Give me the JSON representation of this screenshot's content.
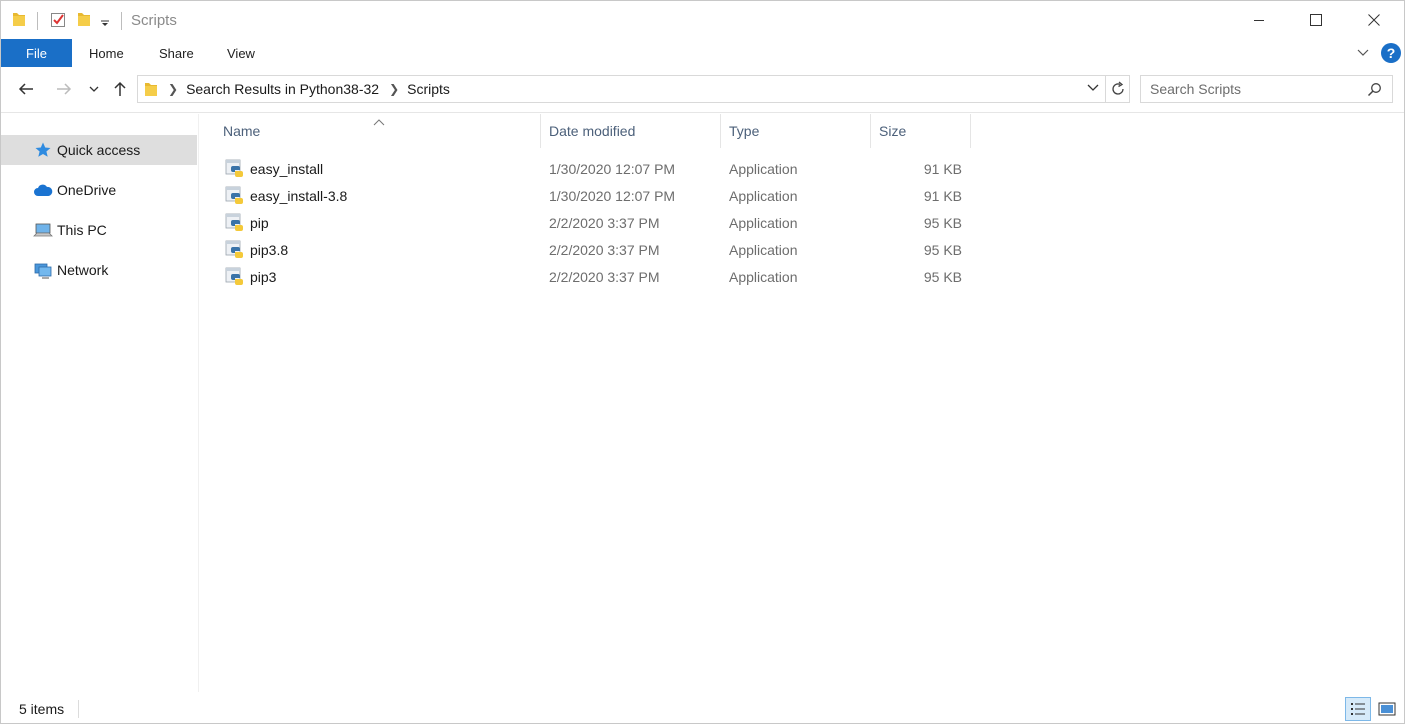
{
  "window": {
    "title": "Scripts"
  },
  "ribbon": {
    "file_label": "File",
    "tabs": [
      "Home",
      "Share",
      "View"
    ],
    "help_label": "?"
  },
  "address": {
    "breadcrumbs": [
      "Search Results in Python38-32",
      "Scripts"
    ]
  },
  "search": {
    "placeholder": "Search Scripts"
  },
  "navpane": {
    "items": [
      {
        "label": "Quick access",
        "icon": "star-icon"
      },
      {
        "label": "OneDrive",
        "icon": "cloud-icon"
      },
      {
        "label": "This PC",
        "icon": "computer-icon"
      },
      {
        "label": "Network",
        "icon": "network-icon"
      }
    ]
  },
  "columns": {
    "name": "Name",
    "date": "Date modified",
    "type": "Type",
    "size": "Size"
  },
  "files": [
    {
      "name": "easy_install",
      "date": "1/30/2020 12:07 PM",
      "type": "Application",
      "size": "91 KB"
    },
    {
      "name": "easy_install-3.8",
      "date": "1/30/2020 12:07 PM",
      "type": "Application",
      "size": "91 KB"
    },
    {
      "name": "pip",
      "date": "2/2/2020 3:37 PM",
      "type": "Application",
      "size": "95 KB"
    },
    {
      "name": "pip3.8",
      "date": "2/2/2020 3:37 PM",
      "type": "Application",
      "size": "95 KB"
    },
    {
      "name": "pip3",
      "date": "2/2/2020 3:37 PM",
      "type": "Application",
      "size": "95 KB"
    }
  ],
  "status": {
    "items_count": "5 items"
  },
  "colors": {
    "accent": "#1a6fc7",
    "selected_nav": "#dedede",
    "header_text": "#4c607a"
  }
}
